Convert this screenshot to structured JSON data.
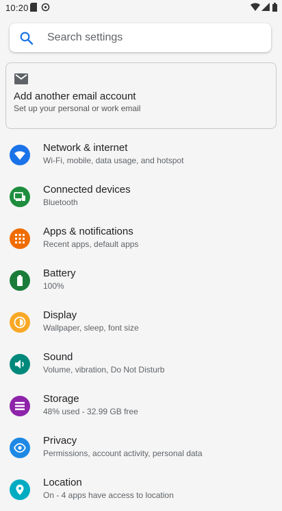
{
  "status_bar": {
    "time": "10:20",
    "icons": [
      "sd-card-icon",
      "sync-icon",
      "wifi-icon",
      "signal-icon",
      "battery-icon"
    ]
  },
  "search": {
    "placeholder": "Search settings"
  },
  "suggestion": {
    "title": "Add another email account",
    "subtitle": "Set up your personal or work email",
    "icon": "gmail-icon"
  },
  "settings_items": [
    {
      "label": "Network & internet",
      "sub": "Wi-Fi, mobile, data usage, and hotspot",
      "icon": "wifi-icon",
      "color": "#1a73e8"
    },
    {
      "label": "Connected devices",
      "sub": "Bluetooth",
      "icon": "connected-devices-icon",
      "color": "#1e8e3e"
    },
    {
      "label": "Apps & notifications",
      "sub": "Recent apps, default apps",
      "icon": "apps-icon",
      "color": "#ef6c00"
    },
    {
      "label": "Battery",
      "sub": "100%",
      "icon": "battery-icon",
      "color": "#1b7c3a"
    },
    {
      "label": "Display",
      "sub": "Wallpaper, sleep, font size",
      "icon": "brightness-icon",
      "color": "#f9a825"
    },
    {
      "label": "Sound",
      "sub": "Volume, vibration, Do Not Disturb",
      "icon": "volume-icon",
      "color": "#00897b"
    },
    {
      "label": "Storage",
      "sub": "48% used - 32.99 GB free",
      "icon": "storage-icon",
      "color": "#8e24aa"
    },
    {
      "label": "Privacy",
      "sub": "Permissions, account activity, personal data",
      "icon": "privacy-eye-icon",
      "color": "#1e88e5"
    },
    {
      "label": "Location",
      "sub": "On - 4 apps have access to location",
      "icon": "location-pin-icon",
      "color": "#00acc1"
    }
  ]
}
